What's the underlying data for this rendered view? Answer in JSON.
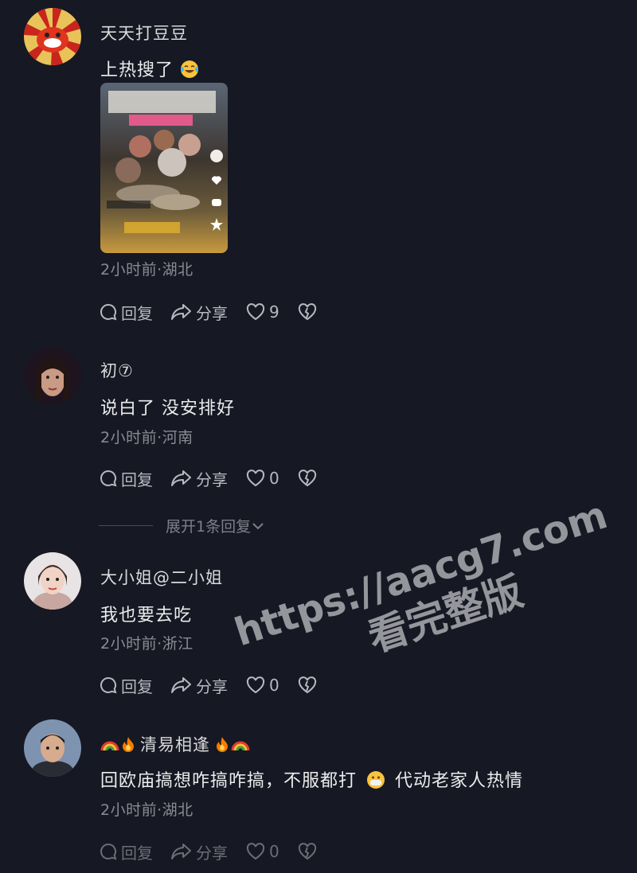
{
  "comments": [
    {
      "username": "天天打豆豆",
      "text": "上热搜了",
      "time_location": "2小时前·湖北",
      "reply_label": "回复",
      "share_label": "分享",
      "likes": "9",
      "emoji": "laughing-tears-emoji"
    },
    {
      "username": "初⑦",
      "text": "说白了 没安排好",
      "time_location": "2小时前·河南",
      "reply_label": "回复",
      "share_label": "分享",
      "likes": "0"
    },
    {
      "username": "大小姐@二小姐",
      "text": "我也要去吃",
      "time_location": "2小时前·浙江",
      "reply_label": "回复",
      "share_label": "分享",
      "likes": "0"
    },
    {
      "username": "清易相逢",
      "text_before": "回欧庙搞想咋搞咋搞，不服都打",
      "text_after": "代动老家人热情",
      "time_location": "2小时前·湖北",
      "reply_label": "回复",
      "share_label": "分享",
      "likes": "0"
    }
  ],
  "expand_replies": "展开1条回复",
  "watermark": {
    "line1": "https://aacg7.com",
    "line2": "看完整版"
  }
}
